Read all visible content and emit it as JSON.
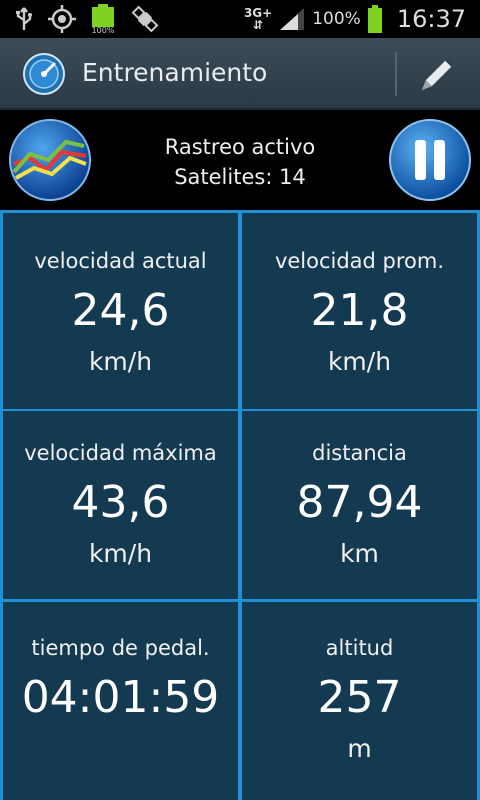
{
  "status_bar": {
    "battery_small_label": "100%",
    "network": "3G+",
    "battery_percent": "100%",
    "time": "16:37"
  },
  "action_bar": {
    "title": "Entrenamiento",
    "app_icon": "speedometer-icon",
    "edit_icon": "pencil-icon"
  },
  "tracking": {
    "status": "Rastreo activo",
    "satellites": "Satelites: 14",
    "chart_icon": "line-chart-globe-icon",
    "pause_icon": "pause-icon"
  },
  "tiles": [
    {
      "label": "velocidad actual",
      "value": "24,6",
      "unit": "km/h"
    },
    {
      "label": "velocidad prom.",
      "value": "21,8",
      "unit": "km/h"
    },
    {
      "label": "velocidad máxima",
      "value": "43,6",
      "unit": "km/h"
    },
    {
      "label": "distancia",
      "value": "87,94",
      "unit": "km"
    },
    {
      "label": "tiempo de pedal.",
      "value": "04:01:59",
      "unit": ""
    },
    {
      "label": "altitud",
      "value": "257",
      "unit": "m"
    }
  ],
  "colors": {
    "tile_bg": "#143a52",
    "grid_border": "#1e90d6",
    "battery_green": "#7ed321"
  }
}
